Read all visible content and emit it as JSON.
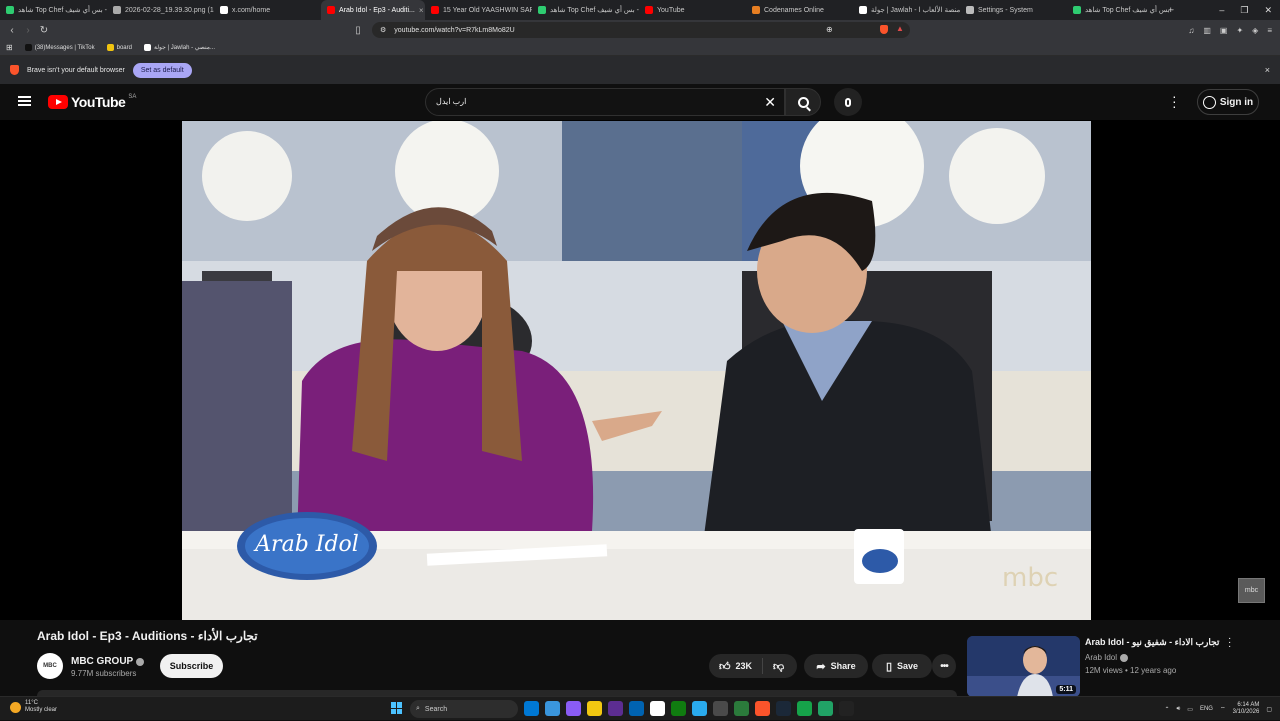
{
  "browser": {
    "tabs": [
      {
        "label": "شاهد Top Chef بس أي شيف -",
        "color": "#2ecc71"
      },
      {
        "label": "2026-02-28_19.39.30.png (14...",
        "color": "#aaaaaa"
      },
      {
        "label": "x.com/home",
        "color": "#ffffff"
      },
      {
        "label": "Arab Idol - Ep3 - Auditi...",
        "color": "#ff0000",
        "active": true
      },
      {
        "label": "15 Year Old YAASHWIN SARA...",
        "color": "#ff0000"
      },
      {
        "label": "شاهد Top Chef بس أي شيف -",
        "color": "#2ecc71"
      },
      {
        "label": "YouTube",
        "color": "#ff0000"
      },
      {
        "label": "Codenames Online",
        "color": "#e67e22"
      },
      {
        "label": "جولة | Jawlah - منصة الألعاب ا...",
        "color": "#ffffff"
      },
      {
        "label": "Settings - System",
        "color": "#bbbbbb"
      },
      {
        "label": "شاهد Top Chef بس أي شيف -",
        "color": "#2ecc71"
      }
    ],
    "new_tab": "+",
    "window_controls": {
      "minimize": "–",
      "restore": "❐",
      "close": "✕"
    },
    "url": "youtube.com/watch?v=R7kLm8Mo82U",
    "bookmarks": [
      {
        "label": "(38)Messages | TikTok",
        "color": "#111111"
      },
      {
        "label": "board",
        "color": "#f1c40f"
      },
      {
        "label": "جولة | Jawlah - منصي...",
        "color": "#ffffff"
      }
    ],
    "infobar": {
      "message": "Brave isn't your default browser",
      "button": "Set as default",
      "close": "×"
    }
  },
  "youtube": {
    "logo_text": "YouTube",
    "country_code": "SA",
    "search_value": "ارب ايدل",
    "clear": "✕",
    "sign_in": "Sign in",
    "watermark": "mbc",
    "video": {
      "title": "Arab Idol - Ep3 - Auditions - تجارب الأداء",
      "channel": "MBC GROUP",
      "channel_avatar": "MBC",
      "subscribers": "9.77M subscribers",
      "subscribe": "Subscribe",
      "likes": "23K",
      "share": "Share",
      "save": "Save",
      "more": "•••"
    },
    "recommended": {
      "title": "Arab Idol - تجارب الاداء - شفيق نيو",
      "channel": "Arab Idol",
      "meta": "12M views • 12 years ago",
      "duration": "5:11"
    }
  },
  "taskbar": {
    "weather_temp": "11°C",
    "weather_desc": "Mostly clear",
    "search_placeholder": "Search",
    "lang": "ENG",
    "time": "6:14 AM",
    "date": "3/10/2026",
    "app_colors": [
      "#0078d4",
      "#3a96dd",
      "#8a5cf5",
      "#f2c811",
      "#5c2d91",
      "#0063b1",
      "#ffffff",
      "#107c10",
      "#2aabee",
      "#4a4a4a",
      "#2b7a3b",
      "#fb542b",
      "#1b2838",
      "#16a34a",
      "#21a366",
      "#222222"
    ]
  }
}
